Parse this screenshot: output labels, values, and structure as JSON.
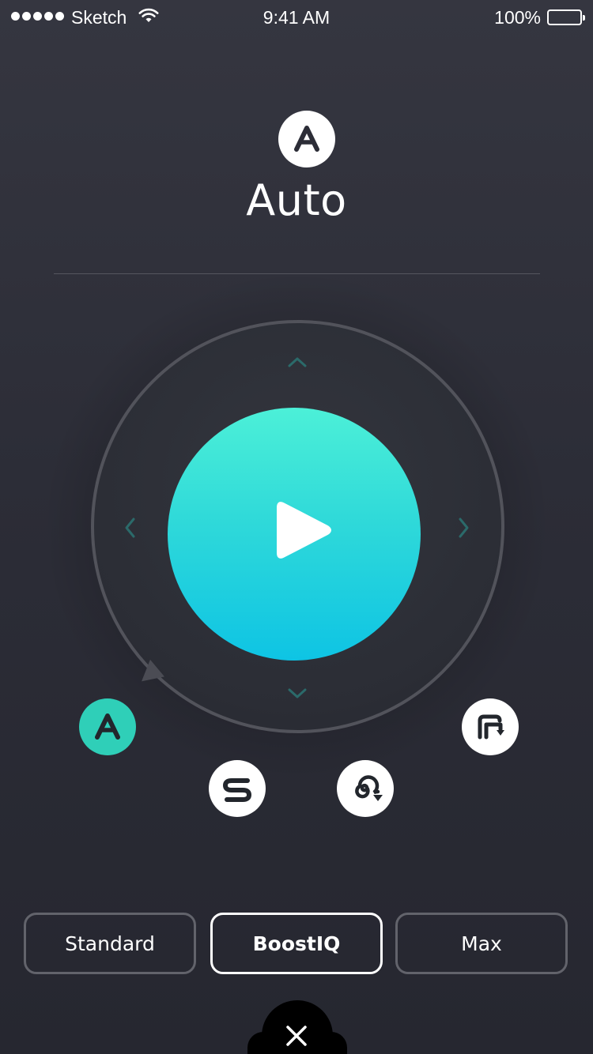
{
  "status_bar": {
    "carrier": "Sketch",
    "time": "9:41 AM",
    "battery_percent": "100%",
    "signal_bars": 5
  },
  "header": {
    "mode_icon": "auto-icon",
    "mode_title": "Auto"
  },
  "controller": {
    "center_icon": "play-icon",
    "arrows": [
      "up",
      "down",
      "left",
      "right"
    ],
    "accent_gradient": [
      "#4cf0d8",
      "#0ec4e4"
    ]
  },
  "modes": [
    {
      "name": "auto",
      "icon": "auto-icon",
      "selected": true
    },
    {
      "name": "spot",
      "icon": "spot-icon",
      "selected": false
    },
    {
      "name": "spiral",
      "icon": "spiral-icon",
      "selected": false
    },
    {
      "name": "edge",
      "icon": "edge-icon",
      "selected": false
    }
  ],
  "suction": {
    "options": [
      "Standard",
      "BoostIQ",
      "Max"
    ],
    "selected": "BoostIQ"
  },
  "close": {
    "icon": "close-icon"
  },
  "colors": {
    "background": "#2c2d37",
    "accent": "#2fcfb8",
    "arrow": "#2b6a6a"
  }
}
